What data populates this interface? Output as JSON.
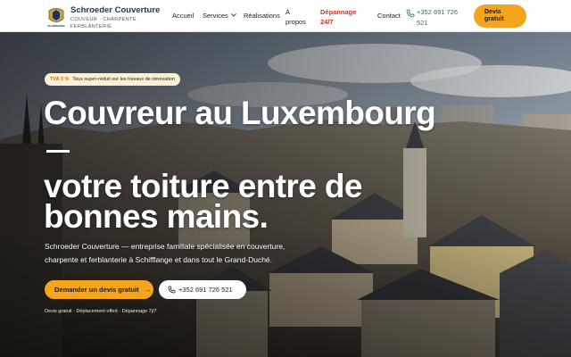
{
  "brand": {
    "name": "Schroeder Couverture",
    "tagline": "Couveur · Charpente · Ferblanterie",
    "logo_text": "SCHROEDER"
  },
  "nav": {
    "items": [
      "Accueil",
      "Services",
      "Réalisations"
    ],
    "apropos": [
      "À",
      "propos"
    ],
    "depannage": [
      "Dépannage",
      "24/7"
    ],
    "contact": "Contact",
    "phone": "+352 691 726 521",
    "devis": [
      "Devis",
      "gratuit"
    ]
  },
  "hero": {
    "badge_accent": "TVA 3 %",
    "badge_text": "Taux super-réduit sur les travaux de rénovation",
    "title_line1": "Couvreur au Luxembourg",
    "title_line2": "votre toiture entre de",
    "title_line3": "bonnes mains.",
    "lead": "Schroeder Couverture — entreprise familiale spécialisée en couverture, charpente et ferblanterie à Schifflange et dans tout le Grand-Duché.",
    "cta_primary": "Demander un devis gratuit",
    "cta_arrow": "→",
    "cta_phone": "+352 691 726 521",
    "footnote": "Devis gratuit · Déplacement offert · Dépannage 7j/7"
  },
  "colors": {
    "accent": "#f5a41e",
    "brand_navy": "#16365c",
    "emergency_red": "#d0321f",
    "phone_teal": "#2a6e66"
  },
  "icons": [
    "crest-logo-icon",
    "chevron-down-icon",
    "phone-icon",
    "arrow-right-icon"
  ]
}
